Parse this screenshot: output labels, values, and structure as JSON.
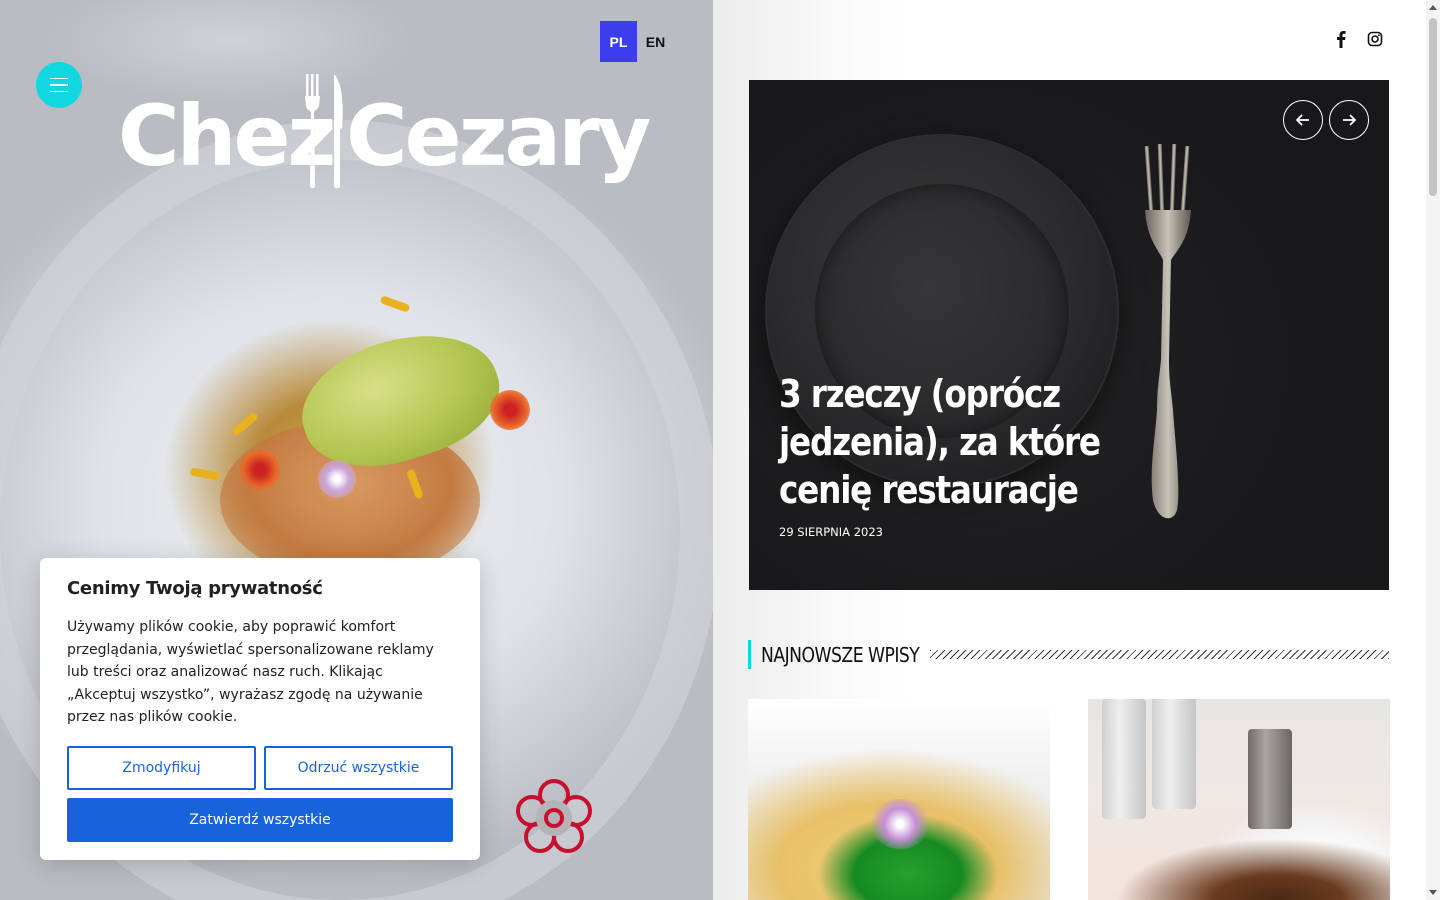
{
  "language_switch": {
    "active": "PL",
    "other": "EN"
  },
  "logo": {
    "text_left": "Chez",
    "text_right": "Cezary"
  },
  "icons": {
    "menu": "hamburger-icon",
    "facebook": "facebook-icon",
    "instagram": "instagram-icon",
    "prev": "arrow-left-icon",
    "next": "arrow-right-icon",
    "michelin": "michelin-flower-icon"
  },
  "colors": {
    "accent": "#11d8e0",
    "lang_active": "#3d3df0",
    "cookie_button": "#1863dc",
    "michelin": "#c8102e"
  },
  "slider": {
    "title": "3 rzeczy (oprócz jedzenia), za które cenię restauracje",
    "date": "29 SIERPNIA 2023"
  },
  "section": {
    "title": "NAJNOWSZE WPISY"
  },
  "cookie": {
    "title": "Cenimy Twoją prywatność",
    "body": "Używamy plików cookie, aby poprawić komfort przeglądania, wyświetlać spersonalizowane reklamy lub treści oraz analizować nasz ruch. Klikając „Akceptuj wszystko”, wyrażasz zgodę na używanie przez nas plików cookie.",
    "customize": "Zmodyfikuj",
    "reject": "Odrzuć wszystkie",
    "accept": "Zatwierdź wszystkie"
  }
}
